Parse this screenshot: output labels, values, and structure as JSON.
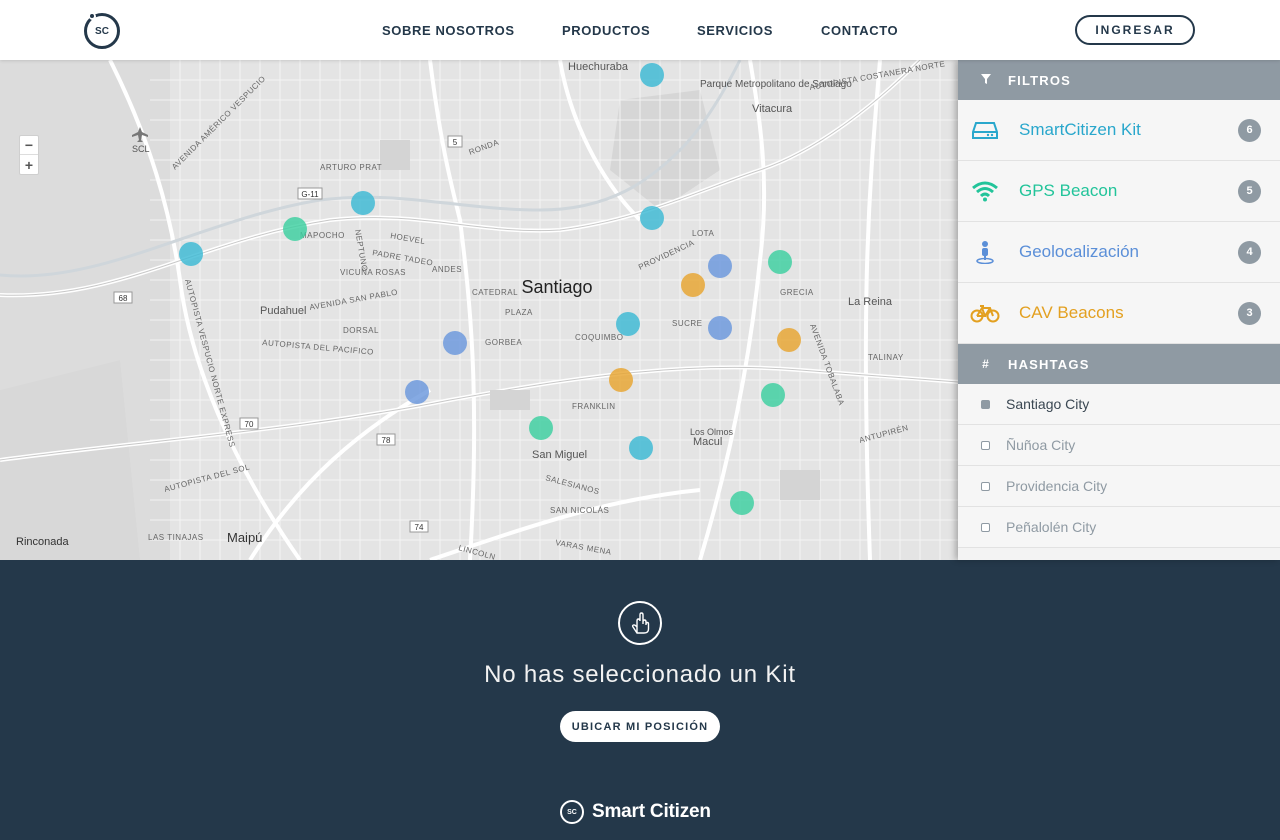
{
  "header": {
    "logo_text": "SC",
    "nav": [
      "SOBRE NOSOTROS",
      "PRODUCTOS",
      "SERVICIOS",
      "CONTACTO"
    ],
    "login_label": "INGRESAR"
  },
  "map": {
    "zoom_out": "−",
    "zoom_in": "+",
    "city_label": "Santiago",
    "place_labels": [
      "Huechuraba",
      "Parque Metropolitano de Santiago",
      "Vitacura",
      "SCL",
      "Pudahuel",
      "La Reina",
      "Macul",
      "San Miguel",
      "Maipú",
      "Rinconada",
      "Los Olmos"
    ],
    "street_labels": [
      "AUTOPISTA COSTANERA NORTE",
      "AVENIDA AMÉRICO VESPUCIO",
      "MAPOCHO",
      "VICUÑA ROSAS",
      "AVENIDA SAN PABLO",
      "AUTOPISTA DEL PACIFICO",
      "AUTOPISTA DEL SOL",
      "AVENIDA TOBALABA",
      "AUTOPISTA VESPUCIO NORTE EXPRESS",
      "GRECIA",
      "TALINAY",
      "ANTUPIRÉN",
      "SALESIANOS",
      "SAN NICOLÁS",
      "VARAS MENA",
      "LINCOLN",
      "LAS TINAJAS",
      "CATEDRAL",
      "GORBEA",
      "FRANKLIN",
      "SUCRE",
      "LOTA",
      "COQUIMBO",
      "PROVIDENCIA",
      "PLAZA",
      "RONDA",
      "DORSAL",
      "HOEVEL",
      "PADRE TADEO",
      "ARTURO PRAT",
      "NEPTUNO",
      "ANDES"
    ],
    "road_shields": [
      "5",
      "68",
      "G-11",
      "70",
      "78",
      "74"
    ],
    "colors": {
      "kit": "#3cb9d4",
      "gps": "#3ccfa0",
      "geo": "#6a97dd",
      "cav": "#e8a530"
    },
    "markers": [
      {
        "type": "kit"
      },
      {
        "type": "kit"
      },
      {
        "type": "kit"
      },
      {
        "type": "kit"
      },
      {
        "type": "kit"
      },
      {
        "type": "kit"
      },
      {
        "type": "gps"
      },
      {
        "type": "gps"
      },
      {
        "type": "gps"
      },
      {
        "type": "gps"
      },
      {
        "type": "gps"
      },
      {
        "type": "geo"
      },
      {
        "type": "geo"
      },
      {
        "type": "geo"
      },
      {
        "type": "geo"
      },
      {
        "type": "cav"
      },
      {
        "type": "cav"
      },
      {
        "type": "cav"
      }
    ]
  },
  "sidebar": {
    "filters_title": "FILTROS",
    "filters": [
      {
        "label": "SmartCitizen Kit",
        "count": "6",
        "color": "#29a7cc",
        "icon": "device-icon"
      },
      {
        "label": "GPS Beacon",
        "count": "5",
        "color": "#22c49a",
        "icon": "wifi-icon"
      },
      {
        "label": "Geolocalización",
        "count": "4",
        "color": "#5b8fd8",
        "icon": "pin-icon"
      },
      {
        "label": "CAV Beacons",
        "count": "3",
        "color": "#e3a020",
        "icon": "bicycle-icon"
      }
    ],
    "hashtags_title": "HASHTAGS",
    "hashtags": [
      {
        "label": "Santiago City",
        "active": true
      },
      {
        "label": "Ñuñoa City",
        "active": false
      },
      {
        "label": "Providencia City",
        "active": false
      },
      {
        "label": "Peñalolén City",
        "active": false
      }
    ]
  },
  "panel": {
    "empty_title": "No has seleccionado un Kit",
    "locate_button": "UBICAR MI POSICIÓN",
    "brand_logo": "SC",
    "brand_name": "Smart Citizen"
  }
}
